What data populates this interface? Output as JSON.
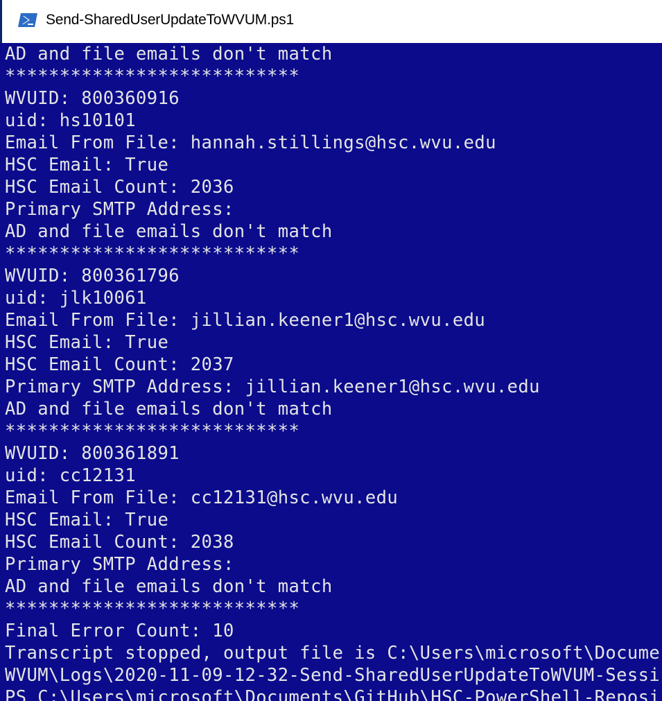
{
  "window": {
    "title": "Send-SharedUserUpdateToWVUM.ps1",
    "icon": "powershell-icon",
    "background_color": "#0b0b8c",
    "text_color": "#e4e4e4"
  },
  "console": {
    "lines": [
      "AD and file emails don't match",
      "***************************",
      "WVUID: 800360916",
      "uid: hs10101",
      "Email From File: hannah.stillings@hsc.wvu.edu",
      "HSC Email: True",
      "HSC Email Count: 2036",
      "Primary SMTP Address:",
      "AD and file emails don't match",
      "***************************",
      "WVUID: 800361796",
      "uid: jlk10061",
      "Email From File: jillian.keener1@hsc.wvu.edu",
      "HSC Email: True",
      "HSC Email Count: 2037",
      "Primary SMTP Address: jillian.keener1@hsc.wvu.edu",
      "AD and file emails don't match",
      "***************************",
      "WVUID: 800361891",
      "uid: cc12131",
      "Email From File: cc12131@hsc.wvu.edu",
      "HSC Email: True",
      "HSC Email Count: 2038",
      "Primary SMTP Address:",
      "AD and file emails don't match",
      "***************************",
      "Final Error Count: 10",
      "Transcript stopped, output file is C:\\Users\\microsoft\\Docume",
      "WVUM\\Logs\\2020-11-09-12-32-Send-SharedUserUpdateToWVUM-Sessi",
      "PS C:\\Users\\microsoft\\Documents\\GitHub\\HSC-PowerShell-Reposi"
    ]
  }
}
